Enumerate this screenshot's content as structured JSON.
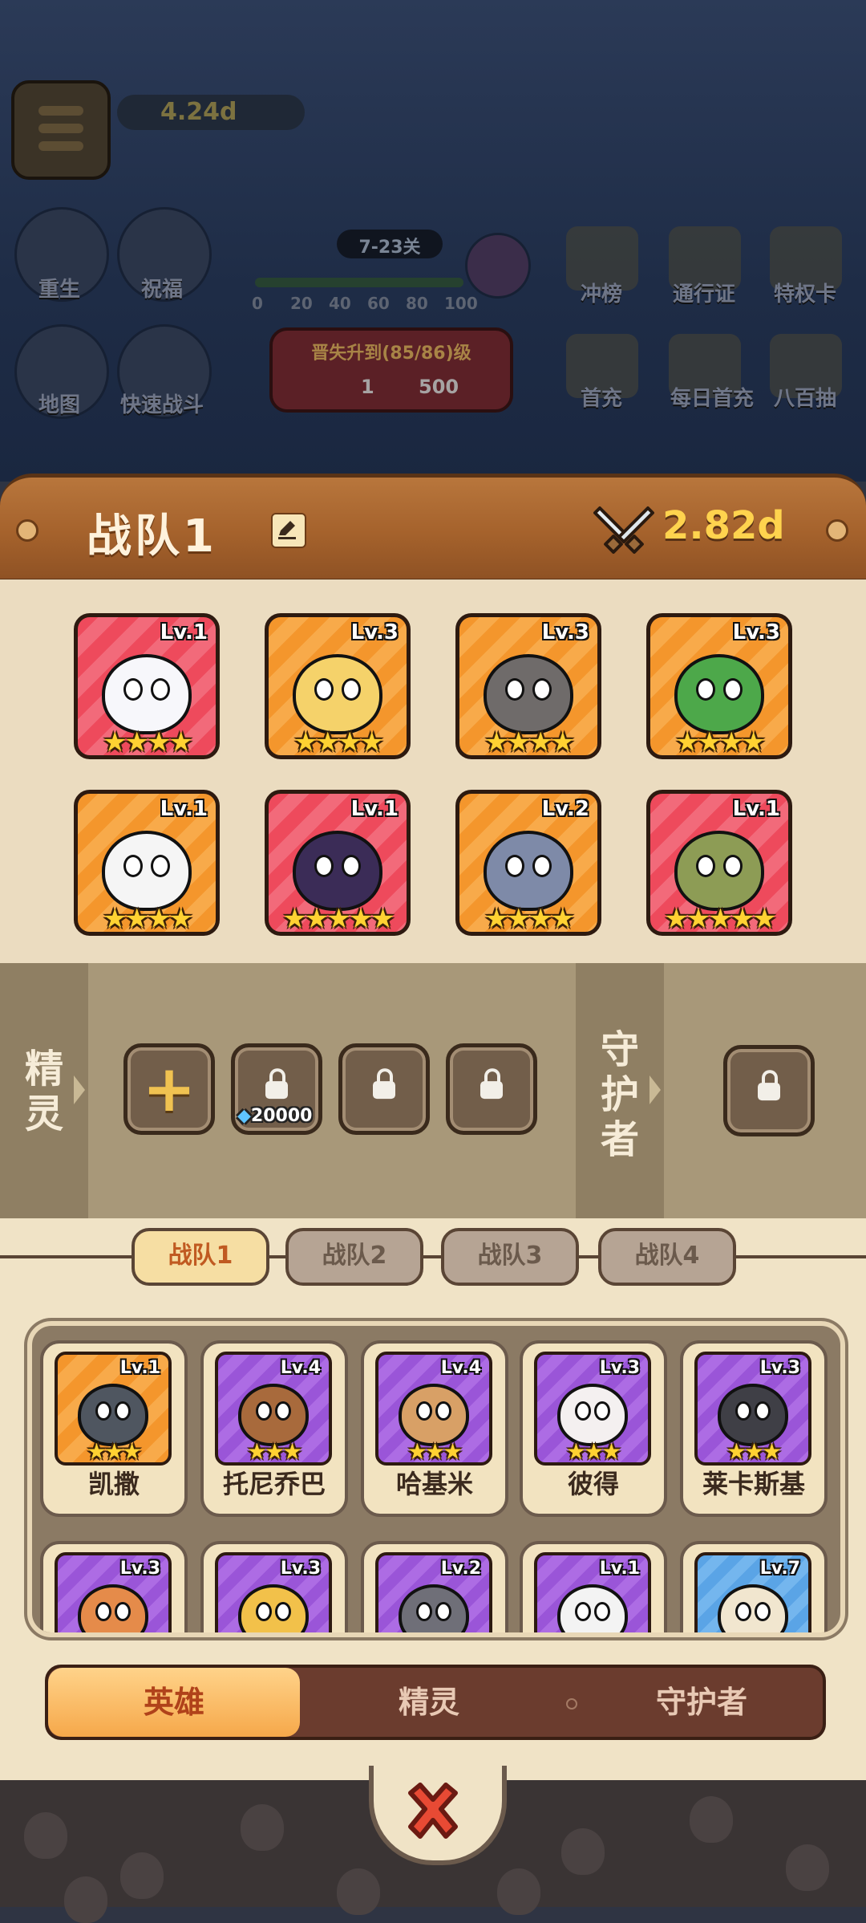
{
  "top_hud": {
    "power": "4.24d",
    "stage": "7-23关",
    "progress_ticks": [
      "0",
      "20",
      "40",
      "60",
      "80",
      "100"
    ],
    "left_buttons": [
      "重生",
      "祝福",
      "地图",
      "快速战斗"
    ],
    "event_buttons": [
      "冲榜",
      "通行证",
      "特权卡",
      "首充",
      "每日首充",
      "八百抽"
    ],
    "upgrade_banner": {
      "text": "晋失升到(85/86)级",
      "cost_a": "1",
      "cost_b": "500"
    }
  },
  "team_header": {
    "title": "战队1",
    "edit_icon": "edit-icon",
    "power": "2.82d"
  },
  "formation": [
    {
      "lv": "Lv.1",
      "stars": 4,
      "bg": "red",
      "color": "#f7f7fb"
    },
    {
      "lv": "Lv.3",
      "stars": 4,
      "bg": "orange",
      "color": "#f5d26a"
    },
    {
      "lv": "Lv.3",
      "stars": 4,
      "bg": "orange",
      "color": "#6f6b6a"
    },
    {
      "lv": "Lv.3",
      "stars": 4,
      "bg": "orange",
      "color": "#4da84a"
    },
    {
      "lv": "Lv.1",
      "stars": 4,
      "bg": "orange",
      "color": "#f5f5f5"
    },
    {
      "lv": "Lv.1",
      "stars": 5,
      "bg": "red",
      "color": "#3b2c57"
    },
    {
      "lv": "Lv.2",
      "stars": 4,
      "bg": "orange",
      "color": "#7e8aa8"
    },
    {
      "lv": "Lv.1",
      "stars": 5,
      "bg": "red",
      "color": "#8d9c55"
    }
  ],
  "spirit_section": {
    "label": "精灵",
    "add_label": "+",
    "unlock_cost": "20000"
  },
  "guardian_section": {
    "label": "守护者"
  },
  "team_tabs": [
    "战队1",
    "战队2",
    "战队3",
    "战队4"
  ],
  "active_team_tab": 0,
  "heroes": [
    {
      "name": "凯撒",
      "lv": "Lv.1",
      "stars": 3,
      "bg": "orange",
      "color": "#4f5660"
    },
    {
      "name": "托尼乔巴",
      "lv": "Lv.4",
      "stars": 3,
      "bg": "purple",
      "color": "#a86a3c"
    },
    {
      "name": "哈基米",
      "lv": "Lv.4",
      "stars": 3,
      "bg": "purple",
      "color": "#d8a066"
    },
    {
      "name": "彼得",
      "lv": "Lv.3",
      "stars": 3,
      "bg": "purple",
      "color": "#f4f0f0"
    },
    {
      "name": "莱卡斯基",
      "lv": "Lv.3",
      "stars": 3,
      "bg": "purple",
      "color": "#3f3f46"
    },
    {
      "name": "",
      "lv": "Lv.3",
      "stars": 0,
      "bg": "purple",
      "color": "#e58b4a"
    },
    {
      "name": "",
      "lv": "Lv.3",
      "stars": 0,
      "bg": "purple",
      "color": "#f2c14a"
    },
    {
      "name": "",
      "lv": "Lv.2",
      "stars": 0,
      "bg": "purple",
      "color": "#6f6f78"
    },
    {
      "name": "",
      "lv": "Lv.1",
      "stars": 0,
      "bg": "purple",
      "color": "#f3f3f3"
    },
    {
      "name": "",
      "lv": "Lv.7",
      "stars": 0,
      "bg": "blue",
      "color": "#f1e6cf"
    }
  ],
  "categories": [
    "英雄",
    "精灵",
    "守护者"
  ],
  "active_category": 0,
  "close_icon": "close-x-icon"
}
